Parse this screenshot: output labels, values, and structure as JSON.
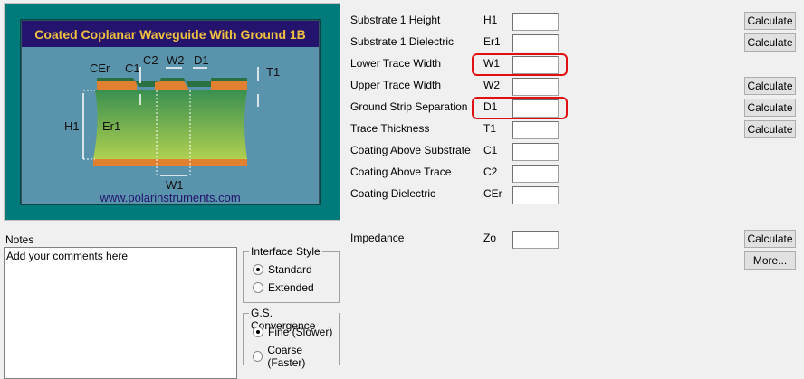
{
  "diagram": {
    "title": "Coated Coplanar Waveguide With Ground 1B",
    "url": "www.polarinstruments.com",
    "labels": {
      "cer": "CEr",
      "c1": "C1",
      "c2": "C2",
      "w2": "W2",
      "d1": "D1",
      "t1": "T1",
      "h1": "H1",
      "er1": "Er1",
      "w1": "W1"
    }
  },
  "params": [
    {
      "label": "Substrate 1 Height",
      "symbol": "H1",
      "value": "",
      "calc": "Calculate"
    },
    {
      "label": "Substrate 1 Dielectric",
      "symbol": "Er1",
      "value": "",
      "calc": "Calculate"
    },
    {
      "label": "Lower Trace Width",
      "symbol": "W1",
      "value": "",
      "calc": null
    },
    {
      "label": "Upper Trace Width",
      "symbol": "W2",
      "value": "",
      "calc": "Calculate"
    },
    {
      "label": "Ground Strip Separation",
      "symbol": "D1",
      "value": "",
      "calc": "Calculate"
    },
    {
      "label": "Trace Thickness",
      "symbol": "T1",
      "value": "",
      "calc": "Calculate"
    },
    {
      "label": "Coating Above Substrate",
      "symbol": "C1",
      "value": "",
      "calc": null
    },
    {
      "label": "Coating Above Trace",
      "symbol": "C2",
      "value": "",
      "calc": null
    },
    {
      "label": "Coating Dielectric",
      "symbol": "CEr",
      "value": "",
      "calc": null
    }
  ],
  "impedance": {
    "label": "Impedance",
    "symbol": "Zo",
    "value": "",
    "calc": "Calculate",
    "more": "More..."
  },
  "notes": {
    "label": "Notes",
    "value": "Add your comments here"
  },
  "interface_style": {
    "title": "Interface Style",
    "options": [
      "Standard",
      "Extended"
    ],
    "selected": "Standard"
  },
  "convergence": {
    "title": "G.S. Convergence",
    "options": [
      "Fine (Slower)",
      "Coarse (Faster)"
    ],
    "selected": "Fine (Slower)"
  },
  "colors": {
    "highlight": "#e01010",
    "frame": "#007b7b",
    "panel": "#5090a8",
    "titlebar": "#24146e",
    "title_text": "#f0c040"
  }
}
